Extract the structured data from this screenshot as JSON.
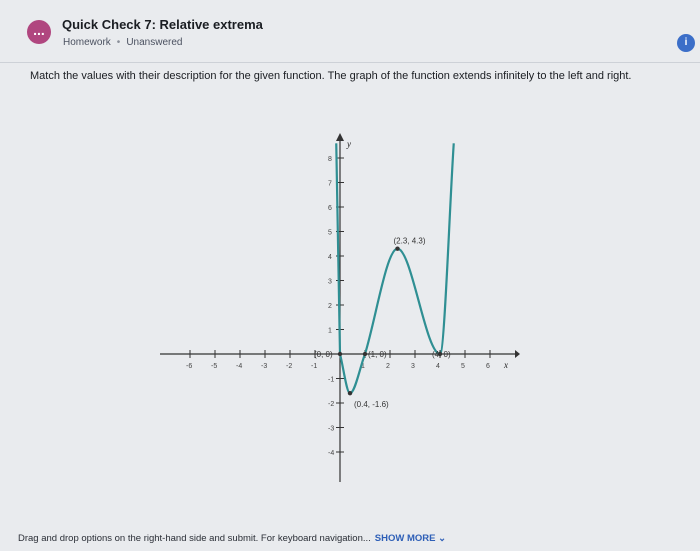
{
  "header": {
    "badge_icon": "...",
    "title": "Quick Check 7: Relative extrema",
    "type": "Homework",
    "status": "Unanswered",
    "info_icon": "i"
  },
  "question": {
    "text": "Match the values with their description for the given function. The graph of the function extends infinitely to the left and right."
  },
  "graph": {
    "axis_x_label": "x",
    "axis_y_label": "y",
    "x_ticks": [
      "-6",
      "-5",
      "-4",
      "-3",
      "-2",
      "-1",
      "1",
      "2",
      "3",
      "4",
      "5",
      "6"
    ],
    "y_ticks": [
      "-4",
      "-3",
      "-2",
      "-1",
      "1",
      "2",
      "3",
      "4",
      "5",
      "6",
      "7",
      "8"
    ],
    "points": [
      {
        "label": "(0, 0)",
        "x": 0,
        "y": 0
      },
      {
        "label": "(1, 0)",
        "x": 1,
        "y": 0
      },
      {
        "label": "(2.3, 4.3)",
        "x": 2.3,
        "y": 4.3
      },
      {
        "label": "(4, 0)",
        "x": 4,
        "y": 0
      },
      {
        "label": "(0.4, -1.6)",
        "x": 0.4,
        "y": -1.6
      }
    ],
    "curve_color": "#2f8f93"
  },
  "footer": {
    "text": "Drag and drop options on the right-hand side and submit. For keyboard navigation...",
    "show_more": "SHOW MORE ⌄"
  }
}
